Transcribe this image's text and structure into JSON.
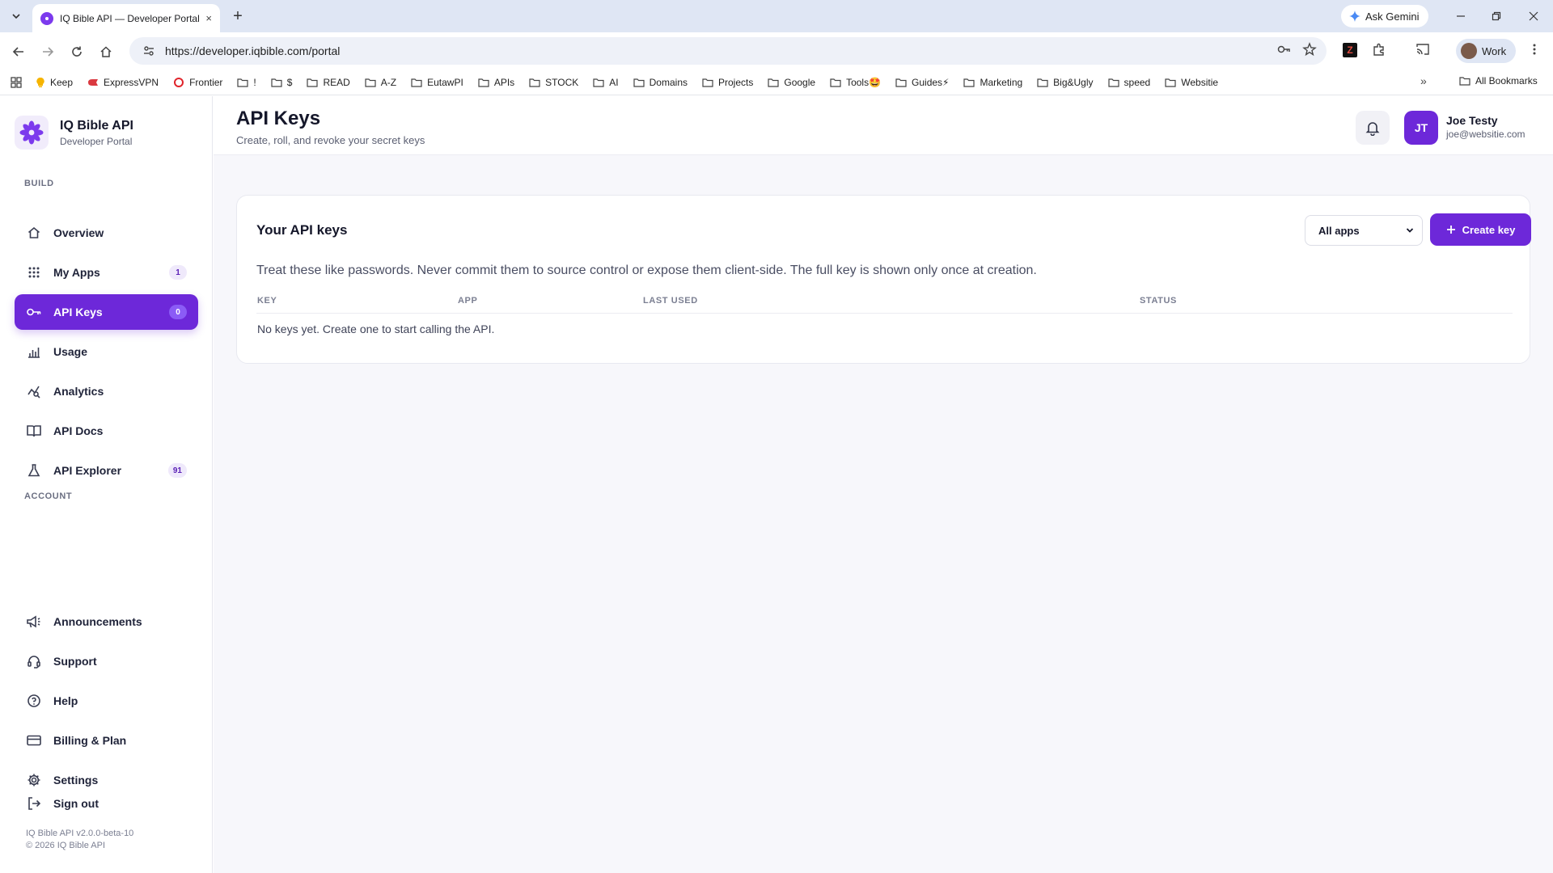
{
  "browser": {
    "tab_title": "IQ Bible API — Developer Portal",
    "tab_close": "×",
    "new_tab": "+",
    "ask_gemini": "Ask Gemini",
    "url": "https://developer.iqbible.com/portal",
    "profile": "Work",
    "ext_z": "Z",
    "bookmarks": [
      "Keep",
      "ExpressVPN",
      "Frontier",
      "!",
      "$",
      "READ",
      "A-Z",
      "EutawPI",
      "APIs",
      "STOCK",
      "AI",
      "Domains",
      "Projects",
      "Google",
      "Tools🤩",
      "Guides⚡",
      "Marketing",
      "Big&Ugly",
      "speed",
      "Websitie"
    ],
    "bookmarks_more": "»",
    "all_bookmarks": "All Bookmarks"
  },
  "brand": {
    "name": "IQ Bible API",
    "sub": "Developer Portal"
  },
  "sidebar": {
    "build_label": "BUILD",
    "account_label": "ACCOUNT",
    "build_items": [
      {
        "label": "Overview",
        "icon": "home-icon"
      },
      {
        "label": "My Apps",
        "icon": "grid-icon",
        "badge": "1"
      },
      {
        "label": "API Keys",
        "icon": "key-icon",
        "badge": "0",
        "active": true
      },
      {
        "label": "Usage",
        "icon": "bar-chart-icon"
      },
      {
        "label": "Analytics",
        "icon": "analytics-icon"
      },
      {
        "label": "API Docs",
        "icon": "book-icon"
      },
      {
        "label": "API Explorer",
        "icon": "flask-icon",
        "badge": "91"
      }
    ],
    "account_items": [
      {
        "label": "Announcements",
        "icon": "megaphone-icon"
      },
      {
        "label": "Support",
        "icon": "headset-icon"
      },
      {
        "label": "Help",
        "icon": "help-icon"
      },
      {
        "label": "Billing & Plan",
        "icon": "credit-card-icon"
      },
      {
        "label": "Settings",
        "icon": "gear-icon"
      }
    ],
    "sign_out": "Sign out",
    "version": "IQ Bible API v2.0.0-beta-10",
    "copyright": "© 2026 IQ Bible API"
  },
  "header": {
    "title": "API Keys",
    "subtitle": "Create, roll, and revoke your secret keys",
    "user_initials": "JT",
    "user_name": "Joe Testy",
    "user_email": "joe@websitie.com"
  },
  "keys_card": {
    "title": "Your API keys",
    "filter_value": "All apps",
    "create_label": "Create key",
    "description": "Treat these like passwords. Never commit them to source control or expose them client-side. The full key is shown only once at creation.",
    "columns": [
      "KEY",
      "APP",
      "LAST USED",
      "STATUS"
    ],
    "empty_message": "No keys yet. Create one to start calling the API."
  },
  "colors": {
    "accent": "#6d28d9",
    "badge_bg": "#efe9fb"
  }
}
